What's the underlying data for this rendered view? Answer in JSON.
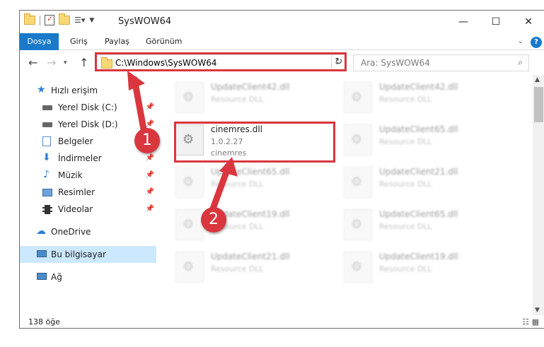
{
  "window": {
    "title": "SysWOW64",
    "minimize_icon": "minimize-icon",
    "maximize_icon": "maximize-icon",
    "close_icon": "close-icon"
  },
  "quick_access_toolbar": {
    "icons": [
      "folder-icon",
      "properties-icon",
      "new-folder-icon",
      "customize-icon"
    ]
  },
  "ribbon": {
    "tabs": [
      "Dosya",
      "Giriş",
      "Paylaş",
      "Görünüm"
    ],
    "active_tab": "Dosya",
    "accent": "#1979ca"
  },
  "navigation": {
    "address_path": "C:\\Windows\\SysWOW64",
    "search_placeholder": "Ara: SysWOW64"
  },
  "nav_pane": {
    "items": [
      {
        "label": "Hızlı erişim",
        "icon": "star-icon"
      },
      {
        "label": "Yerel Disk (C:)",
        "icon": "drive-icon",
        "pinned": true
      },
      {
        "label": "Yerel Disk (D:)",
        "icon": "drive-icon",
        "pinned": true
      },
      {
        "label": "Belgeler",
        "icon": "documents-icon",
        "pinned": true
      },
      {
        "label": "İndirmeler",
        "icon": "download-icon",
        "pinned": true
      },
      {
        "label": "Müzik",
        "icon": "music-icon",
        "pinned": true
      },
      {
        "label": "Resimler",
        "icon": "pictures-icon",
        "pinned": true
      },
      {
        "label": "Videolar",
        "icon": "videos-icon",
        "pinned": true
      },
      {
        "label": "OneDrive",
        "icon": "cloud-icon"
      },
      {
        "label": "Bu bilgisayar",
        "icon": "computer-icon",
        "selected": true
      },
      {
        "label": "Ağ",
        "icon": "network-icon"
      }
    ]
  },
  "files": [
    {
      "name": "UpdateClient42.dll",
      "desc": "Resource DLL"
    },
    {
      "name": "UpdateClient42.dll",
      "desc": "Resource DLL"
    },
    {
      "name": "cinemres.dll",
      "version": "1.0.2.27",
      "company": "cinemres"
    },
    {
      "name": "UpdateClient65.dll",
      "desc": "Resource DLL"
    },
    {
      "name": "UpdateClient65.dll",
      "desc": "Resource DLL"
    },
    {
      "name": "UpdateClient21.dll",
      "desc": "Resource DLL"
    },
    {
      "name": "UpdateClient19.dll",
      "desc": "Resource DLL"
    },
    {
      "name": "UpdateClient65.dll",
      "desc": "Resource DLL"
    },
    {
      "name": "UpdateClient21.dll",
      "desc": "Resource DLL"
    },
    {
      "name": "UpdateClient19.dll",
      "desc": "Resource DLL"
    }
  ],
  "status_bar": {
    "item_count": "138 öğe"
  },
  "annotations": {
    "step1": "1",
    "step2": "2",
    "highlight_color": "#d9363e"
  }
}
